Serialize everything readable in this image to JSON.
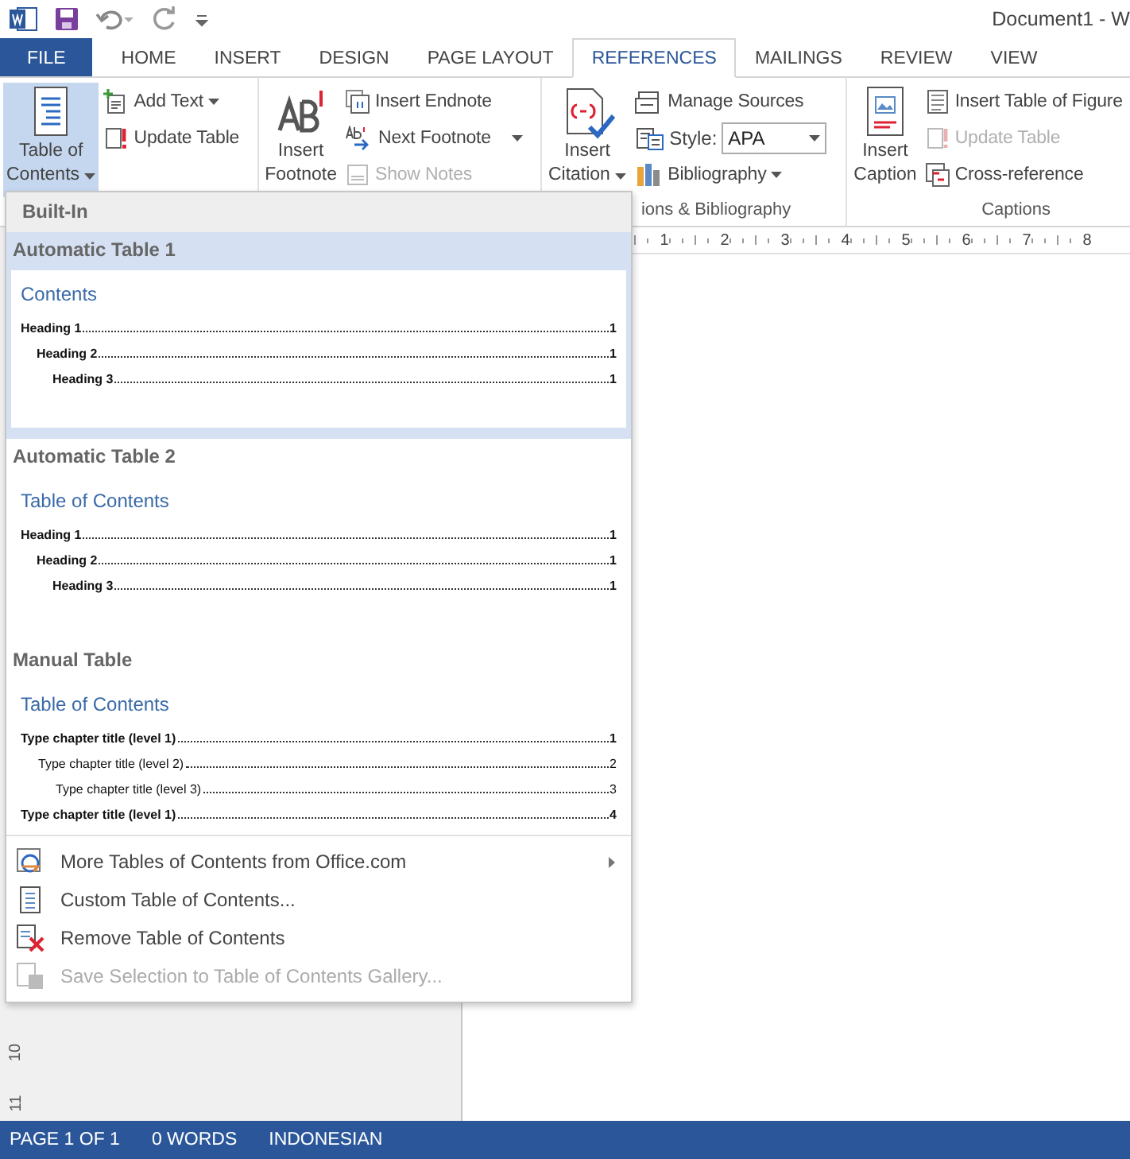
{
  "title_bar": {
    "title": "Document1 - W"
  },
  "tabs": [
    {
      "label": "FILE",
      "kind": "file",
      "selected": false
    },
    {
      "label": "HOME",
      "kind": "tab",
      "selected": false
    },
    {
      "label": "INSERT",
      "kind": "tab",
      "selected": false
    },
    {
      "label": "DESIGN",
      "kind": "tab",
      "selected": false
    },
    {
      "label": "PAGE LAYOUT",
      "kind": "tab",
      "selected": false
    },
    {
      "label": "REFERENCES",
      "kind": "tab",
      "selected": true
    },
    {
      "label": "MAILINGS",
      "kind": "tab",
      "selected": false
    },
    {
      "label": "REVIEW",
      "kind": "tab",
      "selected": false
    },
    {
      "label": "VIEW",
      "kind": "tab",
      "selected": false
    }
  ],
  "ribbon": {
    "groups": [
      {
        "large": {
          "lines": [
            "Table of",
            "Contents"
          ],
          "menu": true,
          "pressed": true
        },
        "items": [
          {
            "kind": "button",
            "label": "Add Text",
            "menu": true,
            "disabled": false
          },
          {
            "kind": "button",
            "label": "Update Table",
            "menu": false,
            "disabled": false
          }
        ]
      },
      {
        "large": {
          "lines": [
            "Insert",
            "Footnote"
          ],
          "menu": false,
          "pressed": false
        },
        "items": [
          {
            "kind": "button",
            "label": "Insert Endnote",
            "menu": false,
            "disabled": false
          },
          {
            "kind": "button",
            "label": "Next Footnote",
            "menu": true,
            "disabled": false
          },
          {
            "kind": "button",
            "label": "Show Notes",
            "menu": false,
            "disabled": true
          }
        ]
      },
      {
        "label": "ions & Bibliography",
        "large": {
          "lines": [
            "Insert",
            "Citation"
          ],
          "menu": true,
          "pressed": false
        },
        "items": [
          {
            "kind": "button",
            "label": "Manage Sources",
            "menu": false,
            "disabled": false
          },
          {
            "kind": "combo",
            "label": "Style:",
            "value": "APA"
          },
          {
            "kind": "button",
            "label": "Bibliography",
            "menu": true,
            "disabled": false
          }
        ]
      },
      {
        "label": "Captions",
        "large": {
          "lines": [
            "Insert",
            "Caption"
          ],
          "menu": false,
          "pressed": false
        },
        "items": [
          {
            "kind": "button",
            "label": "Insert Table of Figure",
            "menu": false,
            "disabled": false
          },
          {
            "kind": "button",
            "label": "Update Table",
            "menu": false,
            "disabled": true
          },
          {
            "kind": "button",
            "label": "Cross-reference",
            "menu": false,
            "disabled": false
          }
        ]
      }
    ]
  },
  "ruler": {
    "horizontal": [
      "1",
      "2",
      "3",
      "4",
      "5",
      "6",
      "7",
      "8"
    ],
    "vertical": [
      "10",
      "11"
    ]
  },
  "toc_menu": {
    "section": "Built-In",
    "gallery": [
      {
        "title": "Automatic Table 1",
        "selected": true,
        "preview": {
          "kind": "automatic",
          "heading": "Contents",
          "entries": [
            {
              "text": "Heading 1",
              "page": "1",
              "children": [
                {
                  "text": "Heading 2",
                  "page": "1",
                  "children": [
                    {
                      "text": "Heading 3",
                      "page": "1"
                    }
                  ]
                }
              ]
            }
          ]
        }
      },
      {
        "title": "Automatic Table 2",
        "selected": false,
        "preview": {
          "kind": "automatic",
          "heading": "Table of Contents",
          "entries": [
            {
              "text": "Heading 1",
              "page": "1",
              "children": [
                {
                  "text": "Heading 2",
                  "page": "1",
                  "children": [
                    {
                      "text": "Heading 3",
                      "page": "1"
                    }
                  ]
                }
              ]
            }
          ]
        }
      },
      {
        "title": "Manual Table",
        "selected": false,
        "preview": {
          "kind": "manual",
          "heading": "Table of Contents",
          "entries": [
            {
              "text": "Type chapter title (level 1)",
              "page": "1",
              "children": [
                {
                  "text": "Type chapter title (level 2)",
                  "page": "2",
                  "children": [
                    {
                      "text": "Type chapter title (level 3)",
                      "page": "3"
                    }
                  ]
                }
              ]
            },
            {
              "text": "Type chapter title (level 1)",
              "page": "4"
            }
          ]
        }
      }
    ],
    "commands": [
      {
        "label": "More Tables of Contents from Office.com",
        "submenu": true,
        "disabled": false
      },
      {
        "label": "Custom Table of Contents...",
        "submenu": false,
        "disabled": false
      },
      {
        "label": "Remove Table of Contents",
        "submenu": false,
        "disabled": false
      },
      {
        "label": "Save Selection to Table of Contents Gallery...",
        "submenu": false,
        "disabled": true
      }
    ]
  },
  "status_bar": [
    "PAGE 1 OF 1",
    "0 WORDS",
    "INDONESIAN"
  ]
}
